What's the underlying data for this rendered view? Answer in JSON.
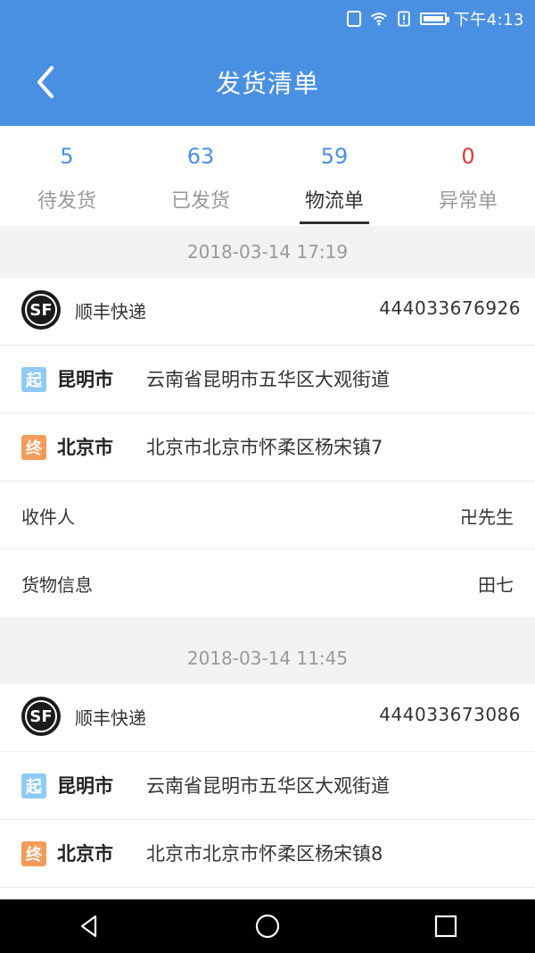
{
  "status_bar": {
    "time": "下午4:13"
  },
  "header": {
    "title": "发货清单",
    "back_icon": "chevron-left-icon"
  },
  "tabs": [
    {
      "count": "5",
      "label": "待发货"
    },
    {
      "count": "63",
      "label": "已发货"
    },
    {
      "count": "59",
      "label": "物流单",
      "active": true
    },
    {
      "count": "0",
      "label": "异常单",
      "status_color": "#e53935"
    }
  ],
  "shipments": [
    {
      "datetime": "2018-03-14 17:19",
      "carrier_logo": "SF",
      "carrier": "顺丰快递",
      "tracking_no": "444033676926",
      "origin": {
        "badge": "起",
        "city": "昆明市",
        "address": "云南省昆明市五华区大观街道"
      },
      "destination": {
        "badge": "终",
        "city": "北京市",
        "address": "北京市北京市怀柔区杨宋镇7"
      },
      "recipient_label": "收件人",
      "recipient": "卍先生",
      "goods_label": "货物信息",
      "goods": "田七"
    },
    {
      "datetime": "2018-03-14 11:45",
      "carrier_logo": "SF",
      "carrier": "顺丰快递",
      "tracking_no": "444033673086",
      "origin": {
        "badge": "起",
        "city": "昆明市",
        "address": "云南省昆明市五华区大观街道"
      },
      "destination": {
        "badge": "终",
        "city": "北京市",
        "address": "北京市北京市怀柔区杨宋镇8"
      }
    }
  ],
  "colors": {
    "primary": "#4a90e2",
    "origin_badge": "#8ecbf4",
    "destination_badge": "#f39c5a",
    "abnormal": "#e53935"
  },
  "nav_icons": [
    "back-triangle-icon",
    "home-circle-icon",
    "recents-square-icon"
  ]
}
